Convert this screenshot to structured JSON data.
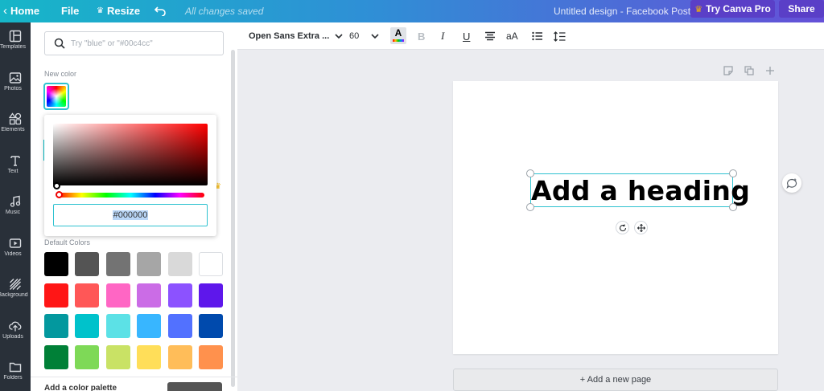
{
  "topbar": {
    "home_label": "Home",
    "file_label": "File",
    "resize_label": "Resize",
    "saved_status": "All changes saved",
    "design_title": "Untitled design - Facebook Post",
    "pro_label": "Try Canva Pro",
    "share_label": "Share",
    "gradient_colors": [
      "#16b6c8",
      "#2f8fd6",
      "#6550d8"
    ]
  },
  "rail": {
    "items": [
      {
        "label": "Templates",
        "icon": "templates-icon"
      },
      {
        "label": "Photos",
        "icon": "photos-icon"
      },
      {
        "label": "Elements",
        "icon": "elements-icon"
      },
      {
        "label": "Text",
        "icon": "text-icon"
      },
      {
        "label": "Music",
        "icon": "music-icon"
      },
      {
        "label": "Videos",
        "icon": "videos-icon"
      },
      {
        "label": "Background",
        "icon": "background-icon"
      },
      {
        "label": "Uploads",
        "icon": "uploads-icon"
      },
      {
        "label": "Folders",
        "icon": "folders-icon"
      }
    ]
  },
  "panel": {
    "search_placeholder": "Try \"blue\" or \"#00c4cc\"",
    "new_color_label": "New color",
    "default_colors_label": "Default Colors",
    "picker": {
      "hex_value": "#000000"
    },
    "default_colors": [
      [
        "#000000",
        "#545454",
        "#737373",
        "#a6a6a6",
        "#d9d9d9",
        "#ffffff"
      ],
      [
        "#ff1616",
        "#ff5757",
        "#ff66c4",
        "#cb6ce6",
        "#8c52ff",
        "#5e17eb"
      ],
      [
        "#03989e",
        "#00c2cb",
        "#5ce1e6",
        "#38b6ff",
        "#5271ff",
        "#004aad"
      ],
      [
        "#008037",
        "#7ed957",
        "#c9e265",
        "#ffde59",
        "#ffbd59",
        "#ff914d"
      ]
    ],
    "bottom_text": "Add a color palette"
  },
  "toolbar": {
    "font_name": "Open Sans Extra ...",
    "font_size": "60",
    "case_label": "aA"
  },
  "canvas": {
    "heading_text": "Add a heading",
    "add_page_label": "+ Add a new page",
    "page_color": "#ffffff",
    "selection_color": "#2ec2d0"
  }
}
